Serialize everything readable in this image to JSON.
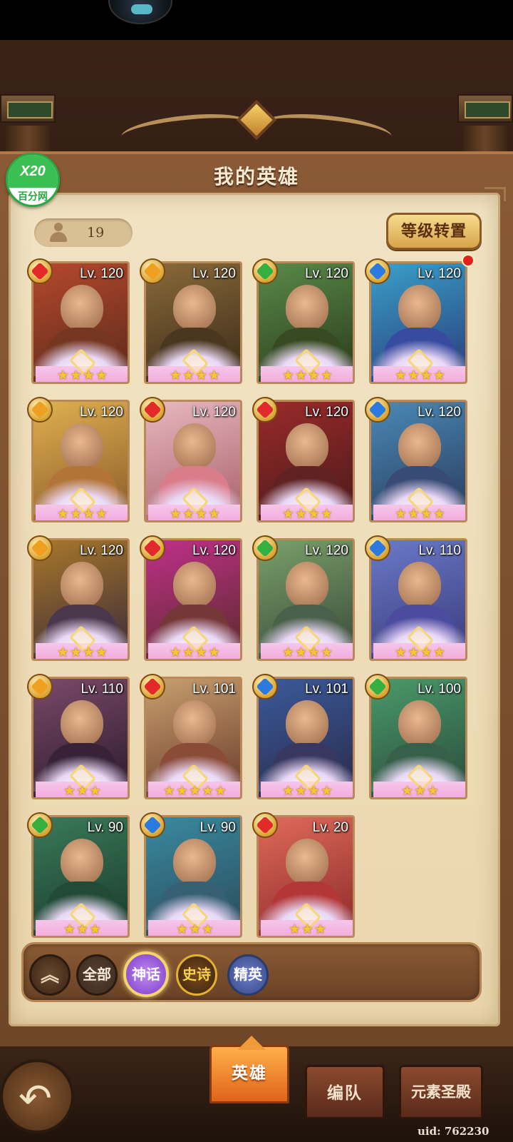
{
  "panel": {
    "title": "我的英雄"
  },
  "logo": {
    "line1": "X20",
    "line2": "百分网"
  },
  "hero_count": "19",
  "level_transfer_label": "等级转置",
  "heroes": [
    {
      "level": "Lv. 120",
      "stars": "★★★★",
      "element": "fire",
      "colors": [
        "#b5482e",
        "#5a2a1a"
      ]
    },
    {
      "level": "Lv. 120",
      "stars": "★★★★",
      "element": "light",
      "colors": [
        "#8a6a3a",
        "#3a2a18"
      ]
    },
    {
      "level": "Lv. 120",
      "stars": "★★★★",
      "element": "nature",
      "colors": [
        "#5a8a4a",
        "#2a3a1a"
      ]
    },
    {
      "level": "Lv. 120",
      "stars": "★★★★",
      "element": "water",
      "colors": [
        "#3aa0c8",
        "#2a3a7a"
      ],
      "notify": true
    },
    {
      "level": "Lv. 120",
      "stars": "★★★★",
      "element": "light",
      "colors": [
        "#e0b050",
        "#8a5a2a"
      ]
    },
    {
      "level": "Lv. 120",
      "stars": "★★★★",
      "element": "fire",
      "colors": [
        "#e8b8c0",
        "#a8606a"
      ]
    },
    {
      "level": "Lv. 120",
      "stars": "★★★★",
      "element": "fire",
      "colors": [
        "#9a2a2a",
        "#4a1a1a"
      ]
    },
    {
      "level": "Lv. 120",
      "stars": "★★★★",
      "element": "water",
      "colors": [
        "#4a8ab8",
        "#2a3a5a"
      ]
    },
    {
      "level": "Lv. 120",
      "stars": "★★★★",
      "element": "light",
      "colors": [
        "#a8782a",
        "#3a2a3a"
      ]
    },
    {
      "level": "Lv. 120",
      "stars": "★★★★",
      "element": "fire",
      "colors": [
        "#c0308a",
        "#5a2a2a"
      ]
    },
    {
      "level": "Lv. 120",
      "stars": "★★★★",
      "element": "nature",
      "colors": [
        "#7aa06a",
        "#3a4a3a"
      ]
    },
    {
      "level": "Lv. 110",
      "stars": "★★★★",
      "element": "water",
      "colors": [
        "#6a7ac8",
        "#3a3a7a"
      ]
    },
    {
      "level": "Lv. 110",
      "stars": "★★★",
      "element": "light",
      "colors": [
        "#7a4a6a",
        "#2a1a2a"
      ]
    },
    {
      "level": "Lv. 101",
      "stars": "★★★★★",
      "element": "fire",
      "colors": [
        "#c8a070",
        "#6a3a2a"
      ]
    },
    {
      "level": "Lv. 101",
      "stars": "★★★★",
      "element": "water",
      "colors": [
        "#3a5a9a",
        "#2a2a4a"
      ]
    },
    {
      "level": "Lv. 100",
      "stars": "★★★",
      "element": "nature",
      "colors": [
        "#4a9a6a",
        "#2a4a3a"
      ]
    },
    {
      "level": "Lv. 90",
      "stars": "★★★",
      "element": "nature",
      "colors": [
        "#3a7a5a",
        "#1a3a2a"
      ]
    },
    {
      "level": "Lv. 90",
      "stars": "★★★",
      "element": "water",
      "colors": [
        "#3a8aa0",
        "#2a4a5a"
      ]
    },
    {
      "level": "Lv. 20",
      "stars": "★★★",
      "element": "fire",
      "colors": [
        "#e06a5a",
        "#8a2a2a"
      ]
    }
  ],
  "element_colors": {
    "fire": "#e32a2a",
    "light": "#f0a020",
    "nature": "#35b040",
    "water": "#2a7ae0"
  },
  "filters": {
    "collapse_icon": "︽",
    "all": "全部",
    "myth": "神话",
    "epic": "史诗",
    "elite": "精英",
    "selected": "myth"
  },
  "tabs": {
    "heroes": "英雄",
    "team": "编队",
    "temple": "元素圣殿",
    "active": "heroes"
  },
  "back_icon": "↶",
  "uid": "uid: 762230"
}
